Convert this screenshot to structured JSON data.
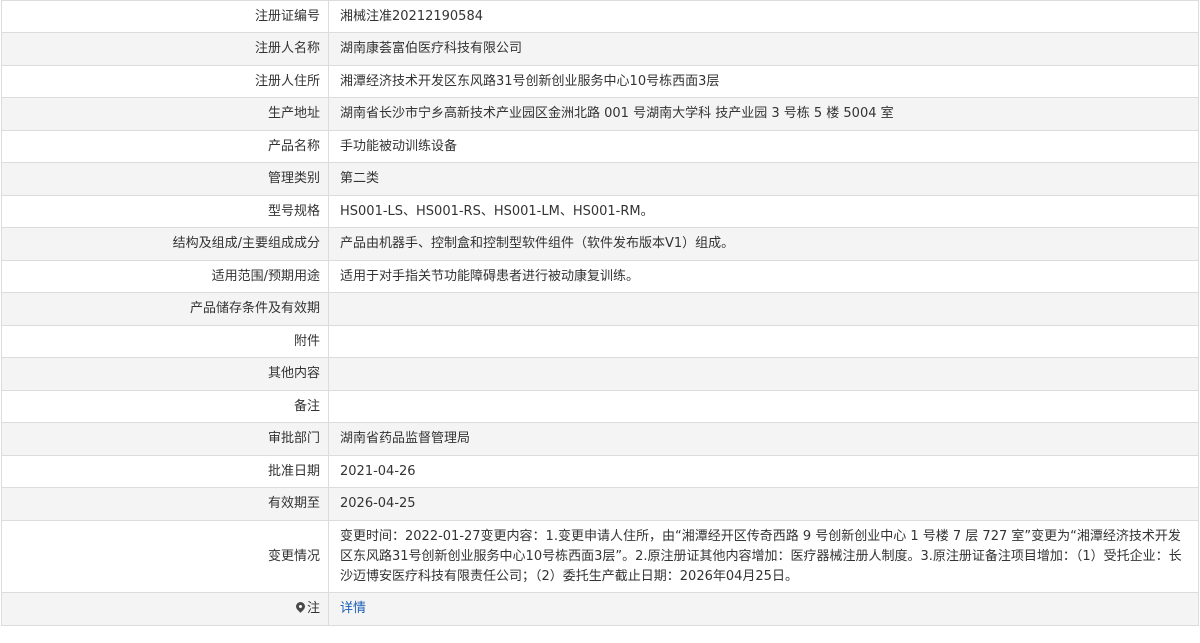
{
  "rows": [
    {
      "label": "注册证编号",
      "value": "湘械注准20212190584"
    },
    {
      "label": "注册人名称",
      "value": "湖南康荟富伯医疗科技有限公司"
    },
    {
      "label": "注册人住所",
      "value": "湘潭经济技术开发区东风路31号创新创业服务中心10号栋西面3层"
    },
    {
      "label": "生产地址",
      "value": "湖南省长沙市宁乡高新技术产业园区金洲北路 001 号湖南大学科 技产业园 3 号栋 5 楼 5004 室"
    },
    {
      "label": "产品名称",
      "value": "手功能被动训练设备"
    },
    {
      "label": "管理类别",
      "value": "第二类"
    },
    {
      "label": "型号规格",
      "value": "HS001-LS、HS001-RS、HS001-LM、HS001-RM。"
    },
    {
      "label": "结构及组成/主要组成成分",
      "value": "产品由机器手、控制盒和控制型软件组件（软件发布版本V1）组成。"
    },
    {
      "label": "适用范围/预期用途",
      "value": "适用于对手指关节功能障碍患者进行被动康复训练。"
    },
    {
      "label": "产品储存条件及有效期",
      "value": ""
    },
    {
      "label": "附件",
      "value": ""
    },
    {
      "label": "其他内容",
      "value": ""
    },
    {
      "label": "备注",
      "value": ""
    },
    {
      "label": "审批部门",
      "value": "湖南省药品监督管理局"
    },
    {
      "label": "批准日期",
      "value": "2021-04-26"
    },
    {
      "label": "有效期至",
      "value": "2026-04-25"
    },
    {
      "label": "变更情况",
      "value": "变更时间：2022-01-27变更内容：1.变更申请人住所，由“湘潭经开区传奇西路 9 号创新创业中心 1 号楼 7 层 727 室”变更为“湘潭经济技术开发区东风路31号创新创业服务中心10号栋西面3层”。2.原注册证其他内容增加：医疗器械注册人制度。3.原注册证备注项目增加：（1）受托企业：长沙迈博安医疗科技有限责任公司；（2）委托生产截止日期：2026年04月25日。"
    }
  ],
  "note": {
    "icon": "map-pin-icon",
    "label": "注",
    "link": "详情"
  }
}
